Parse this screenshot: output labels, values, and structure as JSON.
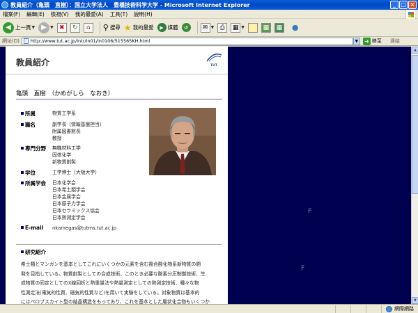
{
  "window": {
    "title": "教員紹介（亀頭　直樹）：国立大学法人　豊橋技術科学大学 - Microsoft Internet Explorer",
    "controls": [
      "_",
      "□",
      "×"
    ]
  },
  "menu": [
    "檔案(F)",
    "編輯(E)",
    "檢視(V)",
    "我的最愛(A)",
    "工具(T)",
    "說明(H)"
  ],
  "toolbar": {
    "back_label": "上一頁",
    "search_label": "搜尋",
    "favorites_label": "我的最愛",
    "media_label": "媒體"
  },
  "address": {
    "label": "網址(D)",
    "url": "http://www.tut.ac.jp/intr/in01/in0106/515565KH.html",
    "go_label": "移至",
    "links_label": "連結"
  },
  "page": {
    "heading": "教員紹介",
    "logo_text": "TUT",
    "person_name": "亀頭　直樹　（かめがしら　なおき）",
    "info": [
      {
        "key": "所属",
        "values": [
          "物質工学系"
        ]
      },
      {
        "key": "職名",
        "values": [
          "副学長（情報基盤担当）",
          "附属図書館長",
          "教授"
        ]
      },
      {
        "key": "専門分野",
        "values": [
          "無機材料工学",
          "固体化学",
          "新物質創製"
        ]
      },
      {
        "key": "学位",
        "values": [
          "工学博士（大阪大学）"
        ]
      },
      {
        "key": "所属学会",
        "values": [
          "日本化学会",
          "日本希土類学会",
          "日本金属学会",
          "日本原子力学会",
          "日本セラミックス協会",
          "日本熱測定学会"
        ]
      },
      {
        "key": "E-mail",
        "values": [
          "nkamegas@tutms.tut.ac.jp"
        ]
      }
    ],
    "research_heading": "研究紹介",
    "research_lines": [
      "希土類とマンガンを基本としてこれにいくつかの元素を含む複合酸化物系新物質の開",
      "発を目指している。物質創製としての合成技術、このとき必要な酸素分圧制御技術、生",
      "成物質の同定としてのX線回折と熱重量法や熱量測定としての熱測定技術、種々な物",
      "性測定法(電気的性質、磁気的性質など)を用いて実験をしている。対象物質は基本的",
      "にはペロブスカイト型の結晶構造をもっており、これを基本とした層状化合物もいくつか"
    ],
    "side_marks": [
      "F",
      "F"
    ]
  },
  "status": {
    "text": "",
    "zone_label": "網際網路"
  },
  "colors": {
    "titlebar": "#0346c4",
    "viewport_bg": "#000050",
    "bullet": "#000080"
  }
}
